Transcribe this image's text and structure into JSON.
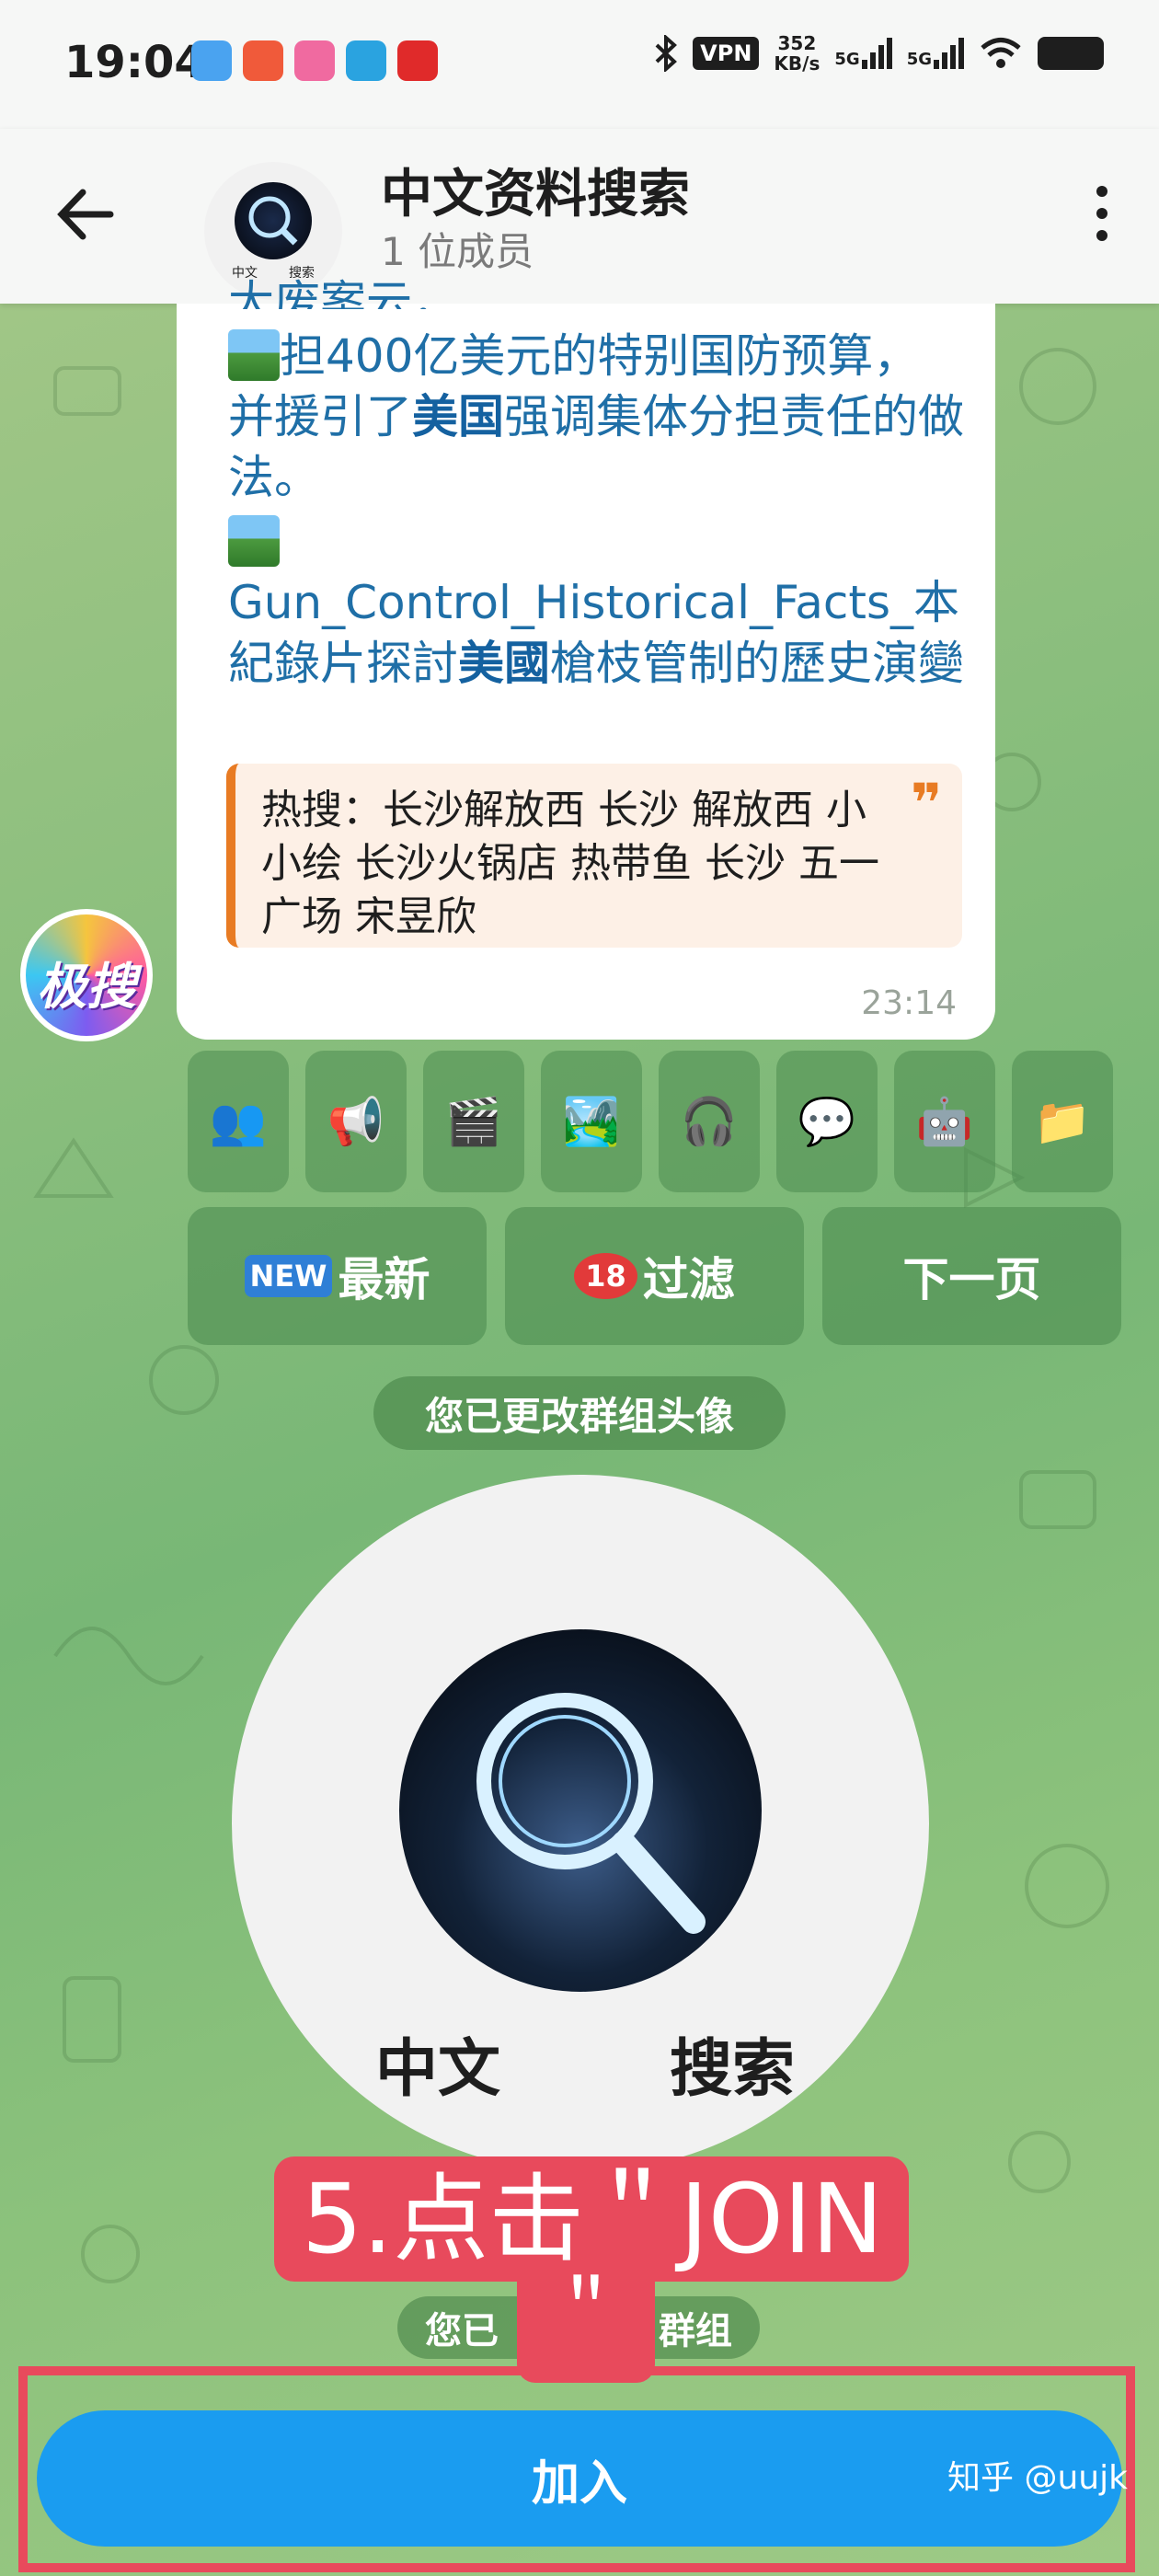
{
  "status_bar": {
    "time": "19:04",
    "vpn": "VPN",
    "speed_value": "352",
    "speed_unit": "KB/s",
    "net1": "5G",
    "net2": "5G"
  },
  "header": {
    "title": "中文资料搜索",
    "subtitle": "1 位成员",
    "avatar_text_left": "中文",
    "avatar_text_right": "搜索"
  },
  "message": {
    "clipped_line": "大废案云，",
    "item1": "担400亿美元的特别国防预算，并援引了",
    "item1_bold": "美国",
    "item1_tail": "强调集体分担责任的做法。",
    "item2": "Gun_Control_Historical_Facts_本紀錄片探討",
    "item2_bold": "美國",
    "item2_tail": "槍枝管制的歷史演變",
    "quote": "热搜：长沙解放西 长沙 解放西 小小绘 长沙火锅店 热带鱼 长沙 五一广场 宋昱欣",
    "quote_mark": "❞",
    "time": "23:14"
  },
  "bot_avatar": {
    "text": "极搜"
  },
  "keyboard_row1": [
    "👥",
    "📢",
    "🎬",
    "🏞️",
    "🎧",
    "💬",
    "🤖",
    "📁"
  ],
  "keyboard_row2": [
    {
      "emoji": "NEW",
      "label": "最新"
    },
    {
      "emoji": "18",
      "label": "过滤"
    },
    {
      "emoji": "",
      "label": "下一页"
    }
  ],
  "service_msgs": {
    "changed_avatar": "您已更改群组头像",
    "joined_left": "您已",
    "joined_right": "群组"
  },
  "big_avatar": {
    "left": "中文",
    "right": "搜索"
  },
  "annotation": {
    "step": "5.点击＂JOIN",
    "quote_end": "＂"
  },
  "join_button": {
    "label": "加入"
  },
  "watermark": "知乎 @uujk"
}
